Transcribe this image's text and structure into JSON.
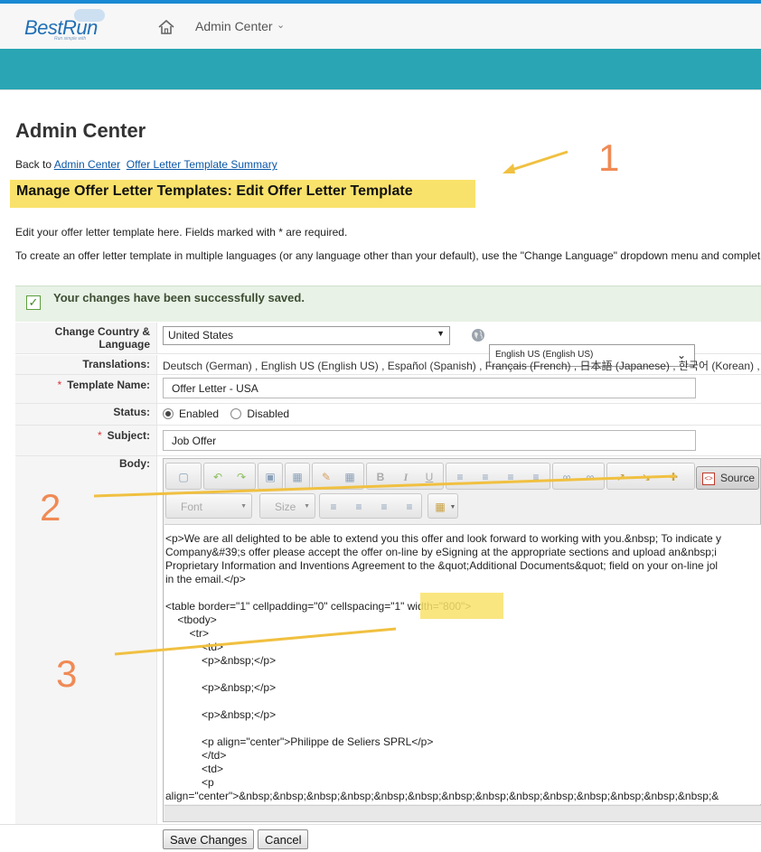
{
  "header": {
    "logo_text": "BestRun",
    "logo_tagline": "Run simple with",
    "nav_title": "Admin Center"
  },
  "page": {
    "title": "Admin Center",
    "back_prefix": "Back to",
    "back_link_admin": "Admin Center",
    "back_link_summary": "Offer Letter Template Summary",
    "subheading": "Manage Offer Letter Templates: Edit Offer Letter Template",
    "intro_line1": "Edit your offer letter template here. Fields marked with * are required.",
    "intro_line2": "To create an offer letter template in multiple languages (or any language other than your default), use the \"Change Language\" dropdown menu and complet"
  },
  "success": {
    "message": "Your changes have been successfully saved."
  },
  "form": {
    "change_country_label_1": "Change Country &",
    "change_country_label_2": "Language",
    "country_value": "United States",
    "language_value": "English US (English US)",
    "translations_label": "Translations:",
    "translations_value": "Deutsch (German) , English US (English US) , Español (Spanish) , Français (French) , 日本語 (Japanese) , 한국어 (Korean) ,",
    "template_name_label": "Template Name:",
    "template_name_value": "Offer Letter - USA",
    "status_label": "Status:",
    "status_enabled": "Enabled",
    "status_disabled": "Disabled",
    "subject_label": "Subject:",
    "subject_value": "Job Offer",
    "body_label": "Body:"
  },
  "editor": {
    "source_label": "Source",
    "font_placeholder": "Font",
    "size_placeholder": "Size",
    "lines": [
      "<p>We are all delighted to be able to extend you this offer and look forward to working with you.&nbsp; To indicate y",
      "Company&#39;s offer please accept the offer on-line by eSigning at the appropriate sections and upload an&nbsp;i",
      "Proprietary Information and Inventions Agreement to the &quot;Additional Documents&quot; field on your on-line jol",
      "in the email.</p>",
      "",
      "<table border=\"1\" cellpadding=\"0\" cellspacing=\"1\" width=\"800\">",
      "    <tbody>",
      "        <tr>",
      "            <td>",
      "            <p>&nbsp;</p>",
      "",
      "            <p>&nbsp;</p>",
      "",
      "            <p>&nbsp;</p>",
      "",
      "            <p align=\"center\">Philippe de Seliers SPRL</p>",
      "            </td>",
      "            <td>",
      "            <p",
      "align=\"center\">&nbsp;&nbsp;&nbsp;&nbsp;&nbsp;&nbsp;&nbsp;&nbsp;&nbsp;&nbsp;&nbsp;&nbsp;&nbsp;&nbsp;&"
    ]
  },
  "buttons": {
    "save": "Save Changes",
    "cancel": "Cancel"
  },
  "annotations": {
    "n1": "1",
    "n2": "2",
    "n3": "3"
  },
  "colors": {
    "teal": "#2aa5b3",
    "highlight": "#f9e26b",
    "annotation": "#f08a55",
    "arrow": "#f0c040"
  }
}
